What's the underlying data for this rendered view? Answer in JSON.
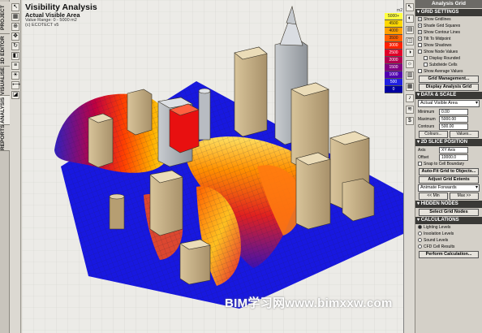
{
  "left_tabs": [
    "PROJECT",
    "3D EDITOR",
    "VISUALISE",
    "ANALYSIS",
    "REPORTS"
  ],
  "viewport": {
    "title": "Visibility Analysis",
    "subtitle": "Actual Visible Area",
    "range": "Value Range: 0 - 5000 m2",
    "source": "(c) ECOTECT v5"
  },
  "legend": {
    "unit": "m2",
    "values": [
      "5000+",
      "4500",
      "4000",
      "3500",
      "3000",
      "2500",
      "2000",
      "1500",
      "1000",
      "500",
      "0"
    ],
    "colors": [
      "#ffff40",
      "#ffd800",
      "#ffa000",
      "#ff6000",
      "#ff2000",
      "#e00028",
      "#b00050",
      "#800080",
      "#5000b0",
      "#2020e0",
      "#0000a0"
    ]
  },
  "panel": {
    "title": "Analysis Grid",
    "grid_settings": {
      "header": "GRID SETTINGS",
      "checks": [
        {
          "label": "Show Gridlines",
          "on": true
        },
        {
          "label": "Shade Grid Squares",
          "on": true
        },
        {
          "label": "Show Contour Lines",
          "on": true
        },
        {
          "label": "Tilt To Midpoint",
          "on": true
        },
        {
          "label": "Show Shadows",
          "on": false
        },
        {
          "label": "Show Node Values",
          "on": false
        },
        {
          "label": "Display Rounded",
          "on": false
        },
        {
          "label": "Subdivide Cells",
          "on": false
        },
        {
          "label": "Show Average Values",
          "on": false
        }
      ],
      "grid_management": "Grid Management...",
      "display_analysis_grid": "Display Analysis Grid"
    },
    "data_scale": {
      "header": "DATA & SCALE",
      "selected": "Actual Visible Area",
      "fields": [
        {
          "label": "Minimum",
          "value": "0.00"
        },
        {
          "label": "Maximum",
          "value": "5000.00"
        },
        {
          "label": "Contours",
          "value": "500.00"
        }
      ],
      "colours": "Colours...",
      "values": "Values..."
    },
    "slice": {
      "header": "2D SLICE POSITION",
      "axis_label": "Axis",
      "axis_value": "XY Axis",
      "offset_label": "Offset",
      "offset_value": "10000.0",
      "snap": "Snap to Cell Boundary",
      "auto_fit": "Auto-Fit Grid to Objects...",
      "adjust": "Adjust Grid Extents",
      "animate": "Animate Forwards",
      "prev": "<< Min",
      "next": "Max >>"
    },
    "hidden_nodes": {
      "header": "HIDDEN NODES",
      "select": "Select Grid Nodes"
    },
    "calculations": {
      "header": "CALCULATIONS",
      "options": [
        {
          "label": "Lighting Levels",
          "on": true
        },
        {
          "label": "Insolation Levels",
          "on": false
        },
        {
          "label": "Sound Levels",
          "on": false
        },
        {
          "label": "CFD Cell Results",
          "on": false
        }
      ],
      "perform": "Perform Calculation..."
    }
  },
  "watermark": "BIM学习网www.bimxxw.com"
}
